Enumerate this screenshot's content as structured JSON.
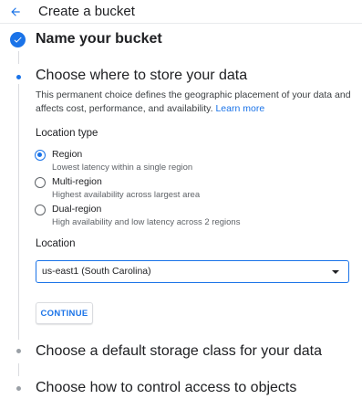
{
  "header": {
    "title": "Create a bucket",
    "back_icon": "arrow-back-icon"
  },
  "steps": [
    {
      "title": "Name your bucket",
      "state": "completed",
      "icon": "check-circle-icon"
    },
    {
      "title": "Choose where to store your data",
      "state": "active"
    },
    {
      "title": "Choose a default storage class for your data",
      "state": "pending"
    },
    {
      "title": "Choose how to control access to objects",
      "state": "pending"
    }
  ],
  "location_step": {
    "description": "This permanent choice defines the geographic placement of your data and affects cost, performance, and availability.",
    "learn_more": "Learn more",
    "location_type_label": "Location type",
    "options": [
      {
        "label": "Region",
        "sub": "Lowest latency within a single region",
        "selected": true
      },
      {
        "label": "Multi-region",
        "sub": "Highest availability across largest area",
        "selected": false
      },
      {
        "label": "Dual-region",
        "sub": "High availability and low latency across 2 regions",
        "selected": false
      }
    ],
    "location_label": "Location",
    "location_value": "us-east1 (South Carolina)",
    "continue_label": "CONTINUE"
  },
  "colors": {
    "accent": "#1a73e8",
    "text": "#202124",
    "secondary_text": "#5f6368",
    "divider": "#dadce0"
  }
}
